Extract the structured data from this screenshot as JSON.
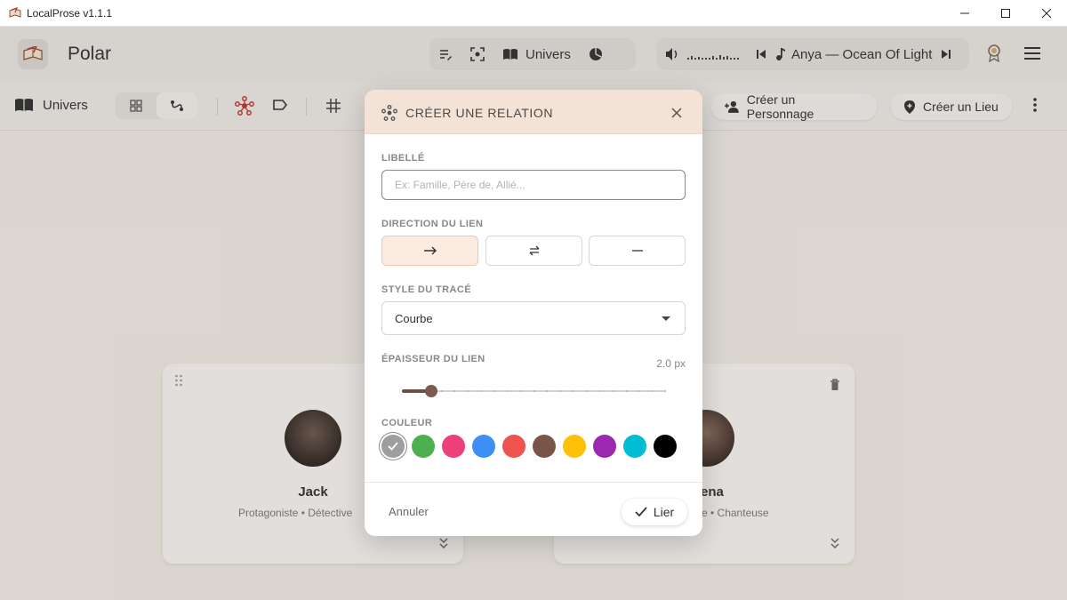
{
  "window": {
    "title": "LocalProse v1.1.1"
  },
  "header": {
    "app_name": "Polar",
    "univers_label": "Univers",
    "track": "Anya — Ocean Of Light"
  },
  "toolbar": {
    "univers_label": "Univers",
    "create_character_label": "Créer un Personnage",
    "create_place_label": "Créer un Lieu"
  },
  "cards": [
    {
      "name": "Jack",
      "role": "Protagoniste • Détective"
    },
    {
      "name": "ena",
      "role": "e • Chanteuse"
    }
  ],
  "modal": {
    "title": "CRÉER UNE RELATION",
    "label_section": "LIBELLÉ",
    "label_placeholder": "Ex: Famille, Père de, Allié...",
    "label_value": "",
    "direction_section": "DIRECTION DU LIEN",
    "direction_options": [
      "unidirectional",
      "bidirectional",
      "none"
    ],
    "direction_selected": "unidirectional",
    "style_section": "STYLE DU TRACÉ",
    "style_selected": "Courbe",
    "thickness_section": "ÉPAISSEUR DU LIEN",
    "thickness_value": "2.0 px",
    "thickness_fraction": 0.11,
    "color_section": "COULEUR",
    "colors": [
      "#9e9e9e",
      "#4caf50",
      "#ec407a",
      "#3f8ef5",
      "#ef5350",
      "#795548",
      "#ffc107",
      "#9c27b0",
      "#00bcd4",
      "#000000"
    ],
    "selected_color_index": 0,
    "cancel_label": "Annuler",
    "confirm_label": "Lier"
  }
}
